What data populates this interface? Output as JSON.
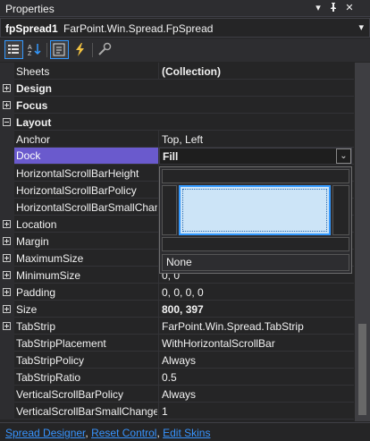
{
  "window": {
    "title": "Properties",
    "icons": [
      "dropdown-arrow-icon",
      "pin-icon",
      "close-icon"
    ]
  },
  "object": {
    "name": "fpSpread1",
    "type": "FarPoint.Win.Spread.FpSpread"
  },
  "toolbar": {
    "buttons": [
      "categorized-icon",
      "alphabetical-icon",
      "properties-icon",
      "events-icon",
      "property-pages-icon"
    ]
  },
  "properties": [
    {
      "name": "Sheets",
      "value": "(Collection)",
      "bold": true
    },
    {
      "name": "Design",
      "category": true,
      "expanded": false
    },
    {
      "name": "Focus",
      "category": true,
      "expanded": false
    },
    {
      "name": "Layout",
      "category": true,
      "expanded": true
    },
    {
      "name": "Anchor",
      "value": "Top, Left"
    },
    {
      "name": "Dock",
      "value": "Fill",
      "selected": true
    },
    {
      "name": "HorizontalScrollBarHeight",
      "value": ""
    },
    {
      "name": "HorizontalScrollBarPolicy",
      "value": ""
    },
    {
      "name": "HorizontalScrollBarSmallChange",
      "value": ""
    },
    {
      "name": "Location",
      "value": "",
      "expandable": true
    },
    {
      "name": "Margin",
      "value": "",
      "expandable": true
    },
    {
      "name": "MaximumSize",
      "value": "",
      "expandable": true
    },
    {
      "name": "MinimumSize",
      "value": "0, 0",
      "expandable": true
    },
    {
      "name": "Padding",
      "value": "0, 0, 0, 0",
      "expandable": true
    },
    {
      "name": "Size",
      "value": "800, 397",
      "expandable": true,
      "bold": true
    },
    {
      "name": "TabStrip",
      "value": "FarPoint.Win.Spread.TabStrip",
      "expandable": true
    },
    {
      "name": "TabStripPlacement",
      "value": "WithHorizontalScrollBar"
    },
    {
      "name": "TabStripPolicy",
      "value": "Always"
    },
    {
      "name": "TabStripRatio",
      "value": "0.5"
    },
    {
      "name": "VerticalScrollBarPolicy",
      "value": "Always"
    },
    {
      "name": "VerticalScrollBarSmallChange",
      "value": "1"
    }
  ],
  "dock_popup": {
    "none_label": "None",
    "selected": "Fill"
  },
  "footer": {
    "links": [
      "Spread Designer",
      "Reset Control",
      "Edit Skins"
    ],
    "separator": ", "
  },
  "colors": {
    "background": "#252526",
    "selection": "#6a5acd",
    "link": "#3794ff",
    "fill_highlight": "#cce4f7"
  }
}
